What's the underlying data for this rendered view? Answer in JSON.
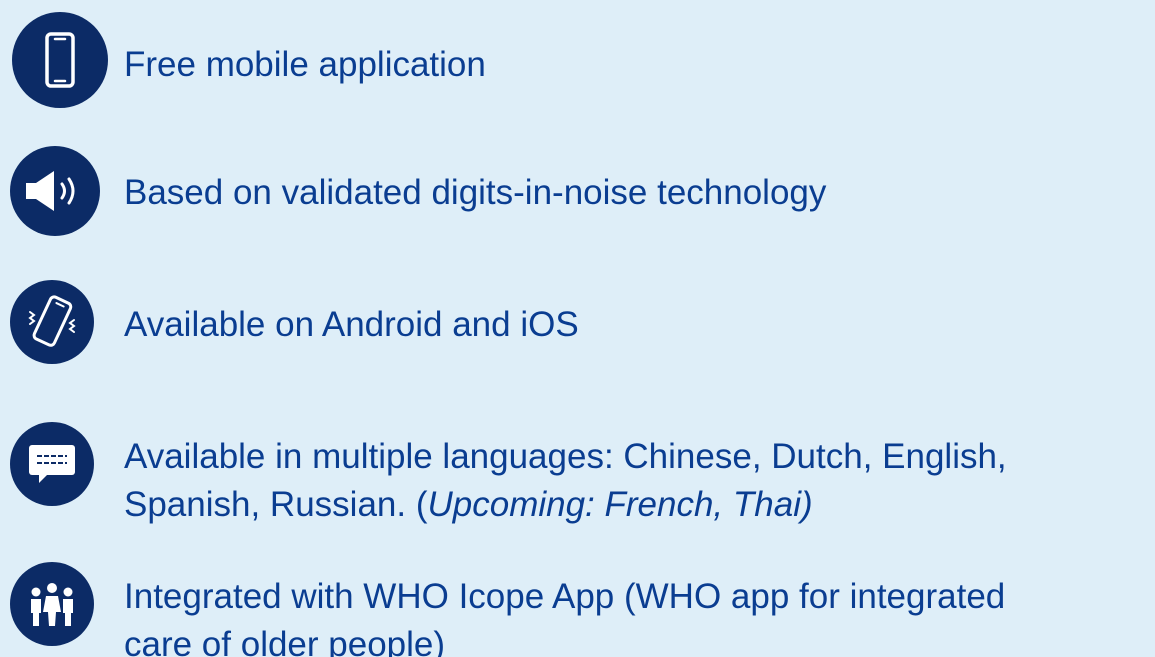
{
  "colors": {
    "background": "#deeef8",
    "text": "#0a3d91",
    "icon_circle": "#0c2b66",
    "icon_glyph": "#ffffff"
  },
  "features": [
    {
      "icon": "smartphone-icon",
      "text": "Free mobile application"
    },
    {
      "icon": "speaker-icon",
      "text": "Based on validated digits-in-noise technology"
    },
    {
      "icon": "vibrating-phone-icon",
      "text": "Available on Android and iOS"
    },
    {
      "icon": "chat-bubble-icon",
      "line1": "Available in multiple languages: Chinese, Dutch, English,",
      "line2_prefix": "Spanish, Russian. (",
      "line2_italic": "Upcoming: French, Thai)"
    },
    {
      "icon": "people-group-icon",
      "line1": "Integrated with WHO Icope App (WHO app for integrated",
      "line2": "care of older people)"
    }
  ]
}
